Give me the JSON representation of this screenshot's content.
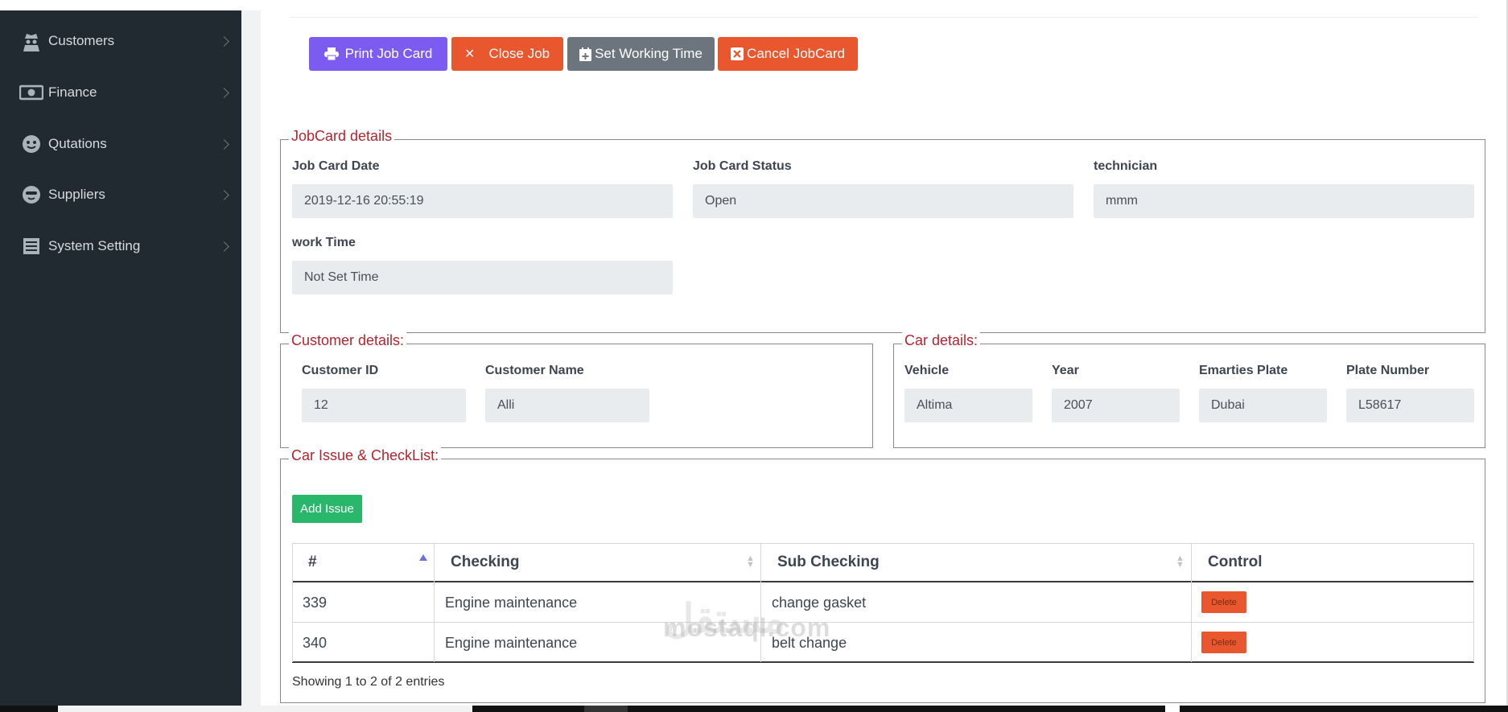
{
  "sidebar": {
    "items": [
      {
        "label": "Customers",
        "icon": "spy-icon"
      },
      {
        "label": "Finance",
        "icon": "money-icon"
      },
      {
        "label": "Qutations",
        "icon": "smile-icon"
      },
      {
        "label": "Suppliers",
        "icon": "face-icon"
      },
      {
        "label": "System Setting",
        "icon": "list-icon"
      }
    ]
  },
  "toolbar": {
    "print_label": "Print Job Card",
    "close_label": "Close Job",
    "time_label": "Set Working Time",
    "cancel_label": "Cancel JobCard"
  },
  "jobcard": {
    "legend": "JobCard details",
    "date_label": "Job Card Date",
    "date_value": "2019-12-16 20:55:19",
    "status_label": "Job Card Status",
    "status_value": "Open",
    "tech_label": "technician",
    "tech_value": "mmm",
    "work_label": "work Time",
    "work_value": "Not Set Time"
  },
  "customer": {
    "legend": "Customer details:",
    "id_label": "Customer ID",
    "id_value": "12",
    "name_label": "Customer Name",
    "name_value": "Alli"
  },
  "car": {
    "legend": "Car details:",
    "vehicle_label": "Vehicle",
    "vehicle_value": "Altima",
    "year_label": "Year",
    "year_value": "2007",
    "plate_label": "Emarties Plate",
    "plate_value": "Dubai",
    "number_label": "Plate Number",
    "number_value": "L58617"
  },
  "issues": {
    "legend": "Car Issue & CheckList:",
    "add_label": "Add Issue",
    "columns": [
      "#",
      "Checking",
      "Sub Checking",
      "Control"
    ],
    "rows": [
      {
        "id": "339",
        "checking": "Engine maintenance",
        "sub": "change gasket",
        "control": "Delete"
      },
      {
        "id": "340",
        "checking": "Engine maintenance",
        "sub": "belt change",
        "control": "Delete"
      }
    ],
    "info": "Showing 1 to 2 of 2 entries"
  },
  "watermark": {
    "latin": "mostaql.com",
    "arabic": "مستقل"
  },
  "colors": {
    "sidebar": "#212931",
    "primary": "#7c5cf0",
    "danger": "#e8572d",
    "secondary": "#6c757d",
    "success": "#28b76b",
    "legend": "#b3242e"
  }
}
